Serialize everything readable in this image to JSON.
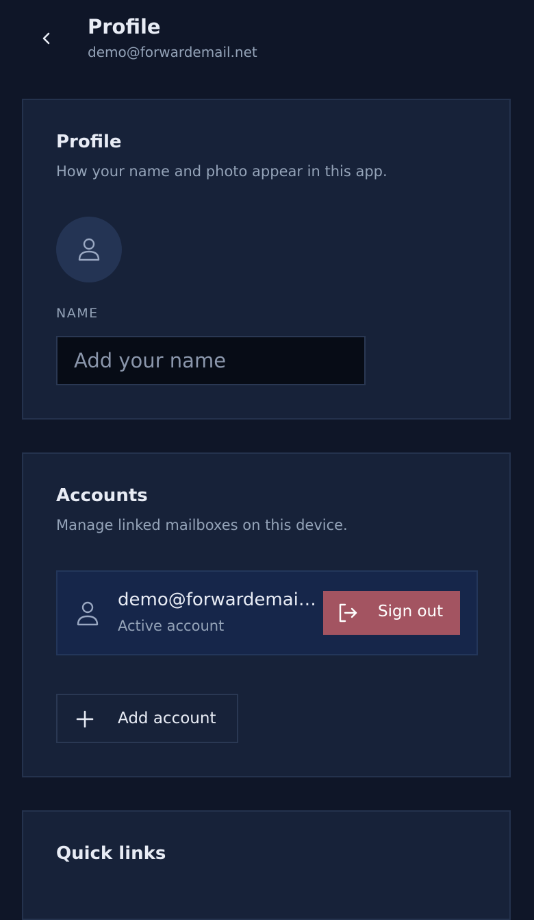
{
  "header": {
    "title": "Profile",
    "subtitle": "demo@forwardemail.net",
    "back_icon": "chevron-left-icon"
  },
  "profile_card": {
    "title": "Profile",
    "description": "How your name and photo appear in this app.",
    "avatar_icon": "user-icon",
    "name_label": "NAME",
    "name_value": "",
    "name_placeholder": "Add your name"
  },
  "accounts_card": {
    "title": "Accounts",
    "description": "Manage linked mailboxes on this device.",
    "accounts": [
      {
        "email": "demo@forwardemail.net",
        "status": "Active account",
        "signout_label": "Sign out"
      }
    ],
    "add_account_label": "Add account"
  },
  "quick_links_card": {
    "title": "Quick links"
  },
  "colors": {
    "background": "#0f1628",
    "card": "#172239",
    "signout": "#a35461",
    "account_row": "#16264a"
  }
}
